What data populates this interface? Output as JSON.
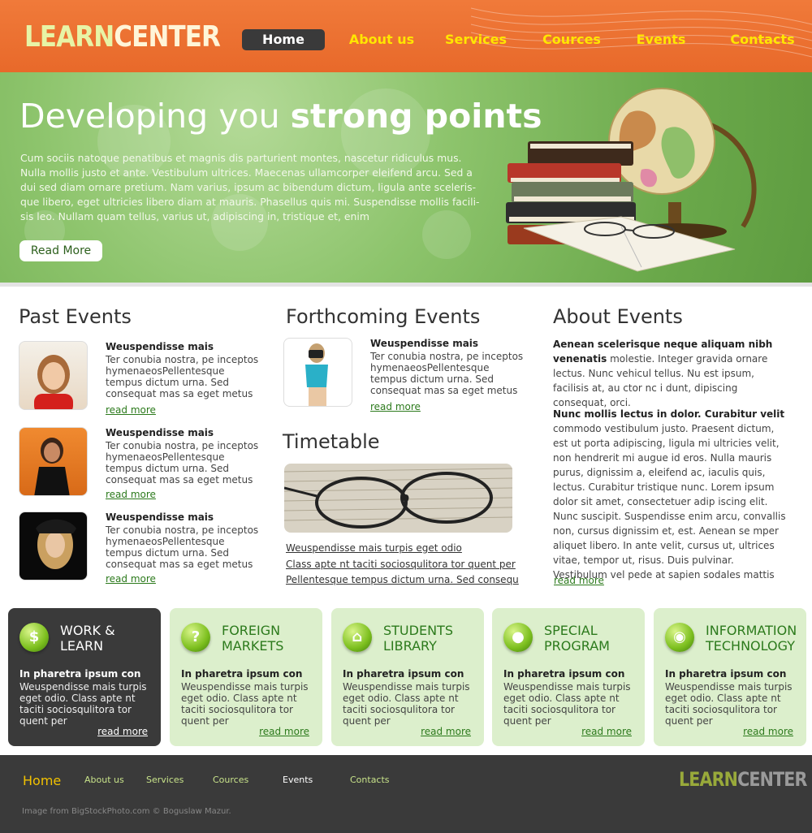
{
  "brand": {
    "logo_part1": "LEARN",
    "logo_part2": "CENTER"
  },
  "nav": [
    "Home",
    "About us",
    "Services",
    "Cources",
    "Events",
    "Contacts"
  ],
  "hero": {
    "title_regular": "Developing you ",
    "title_bold": "strong points",
    "text": "Cum sociis natoque penatibus et magnis dis parturient montes, nascetur ridiculus mus. Nulla mollis justo et ante. Vestibulum ultrices. Maecenas ullamcorper eleifend arcu. Sed a dui sed diam ornare pretium. Nam varius, ipsum ac bibendum dictum, ligula ante sceleris-que libero, eget ultricies libero diam at mauris. Phasellus quis mi. Suspendisse mollis facili-sis leo. Nullam quam tellus, varius ut, adipiscing in, tristique et, enim",
    "button": "Read More"
  },
  "past_events": {
    "heading": "Past Events",
    "items": [
      {
        "title": "Weuspendisse mais",
        "text": "Ter conubia nostra, pe inceptos hymenaeosPellentesque tempus dictum urna. Sed consequat mas sa eget metus",
        "link": "read more"
      },
      {
        "title": "Weuspendisse mais",
        "text": "Ter conubia nostra, pe inceptos hymenaeosPellentesque tempus dictum urna. Sed consequat mas sa eget metus",
        "link": "read more"
      },
      {
        "title": "Weuspendisse mais",
        "text": "Ter conubia nostra, pe inceptos hymenaeosPellentesque tempus dictum urna. Sed consequat mas sa eget metus",
        "link": "read more"
      }
    ]
  },
  "forthcoming_events": {
    "heading": "Forthcoming Events",
    "item": {
      "title": "Weuspendisse mais",
      "text": "Ter conubia nostra, pe inceptos hymenaeosPellentesque tempus dictum urna. Sed consequat mas sa eget metus",
      "link": "read more"
    }
  },
  "timetable": {
    "heading": "Timetable",
    "links": [
      "Weuspendisse mais turpis eget odio",
      "Class apte nt taciti sociosqulitora tor quent per",
      "Pellentesque tempus dictum urna. Sed consequ"
    ]
  },
  "about_events": {
    "heading": "About Events",
    "block1_bold": "Aenean scelerisque neque aliquam nibh venenatis",
    "block1_text": " molestie. Integer gravida ornare lectus. Nunc vehicul tellus. Nu est ipsum, facilisis at, au ctor nc i dunt, dipiscing consequat, orci.",
    "block2_bold": "Nunc mollis lectus in dolor. Curabitur velit",
    "block2_text": " commodo vestibulum justo. Praesent dictum, est ut porta adipiscing, ligula mi ultricies velit, non hendrerit mi augue id eros. Nulla mauris purus, dignissim a, eleifend ac, iaculis quis, lectus. Curabitur tristique nunc. Lorem ipsum dolor sit amet, consectetuer adip iscing elit. Nunc suscipit. Suspendisse enim arcu, convallis non, cursus dignissim et, est. Aenean se mper aliquet libero. In ante velit, cursus ut, ultrices vitae, tempor ut, risus. Duis pulvinar. Vestibulum vel pede at sapien sodales mattis",
    "link": "read more"
  },
  "features": [
    {
      "title_line1": "WORK &",
      "title_line2": "LEARN",
      "icon": "dollar-icon",
      "glyph": "$",
      "sub": "In pharetra ipsum con",
      "text": "Weuspendisse mais turpis eget odio. Class apte nt taciti sociosqulitora tor quent per",
      "link": "read more"
    },
    {
      "title_line1": "FOREIGN",
      "title_line2": "MARKETS",
      "icon": "question-icon",
      "glyph": "?",
      "sub": "In pharetra ipsum con",
      "text": "Weuspendisse mais turpis eget odio. Class apte nt taciti sociosqulitora tor quent per",
      "link": "read more"
    },
    {
      "title_line1": "STUDENTS",
      "title_line2": "LIBRARY",
      "icon": "home-icon",
      "glyph": "⌂",
      "sub": "In pharetra ipsum con",
      "text": "Weuspendisse mais turpis eget odio. Class apte nt taciti sociosqulitora tor quent per",
      "link": "read more"
    },
    {
      "title_line1": "SPECIAL",
      "title_line2": "PROGRAM",
      "icon": "pin-icon",
      "glyph": "●",
      "sub": "In pharetra ipsum con",
      "text": "Weuspendisse mais turpis eget odio. Class apte nt taciti sociosqulitora tor quent per",
      "link": "read more"
    },
    {
      "title_line1": "INFORMATION",
      "title_line2": "TECHNOLOGY",
      "icon": "disc-icon",
      "glyph": "◉",
      "sub": "In pharetra ipsum con",
      "text": "Weuspendisse mais turpis eget odio. Class apte nt taciti sociosqulitora tor quent per",
      "link": "read more"
    }
  ],
  "footer": {
    "nav": [
      "Home",
      "About us",
      "Services",
      "Cources",
      "Events",
      "Contacts"
    ],
    "logo_part1": "LEARN",
    "logo_part2": "CENTER",
    "credit": "Image from BigStockPhoto.com © Boguslaw Mazur."
  },
  "colors": {
    "header": "#e8692a",
    "accent_green": "#2c7a1c",
    "nav_link": "#ffe600",
    "dark": "#3a3a3a",
    "box_light": "#dcefcc"
  }
}
